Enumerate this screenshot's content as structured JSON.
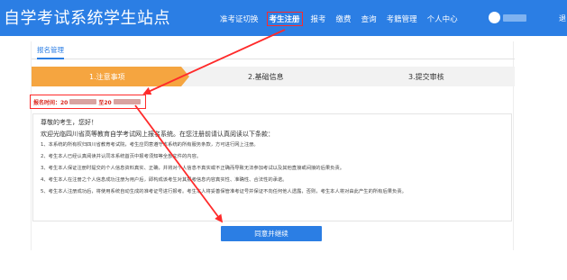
{
  "header": {
    "site_title": "自学考试系统学生站点",
    "nav": [
      "准考证切换",
      "考生注册",
      "报考",
      "缴费",
      "查询",
      "考籍管理",
      "个人中心"
    ],
    "active_nav": "考生注册",
    "right_text": "退"
  },
  "tab": {
    "label": "报名管理"
  },
  "steps": [
    "1.注意事项",
    "2.基础信息",
    "3.提交审核"
  ],
  "time": {
    "prefix": "报名时间：20",
    "middle": "至20"
  },
  "notice": {
    "greeting": "尊敬的考生，您好！",
    "intro": "欢迎光临四川省高等教育自学考试网上报名系统。在您注册前请认真阅读以下条款：",
    "items": [
      "1、本系统的所有权归四川省教育考试院，考生应同意遵守本系统的所有服务条款，方可进行网上注册。",
      "2、考生本人已经认真阅读并认同本系统首页中报考须知等全部文件的内容。",
      "3、考生本人保证注册时提交的个人信息资料真实、正确，并将对个人信息不真实或不正确而导致无法参加考试以及其他直接或间接的后果负责。",
      "4、考生本人在注册之个人信息成功注册为用户后，即构成该考生对其报考信息内容真实性、准确性、合法性的承诺。",
      "5、考生本人注册成功后，将使用系统自动生成的准考证号进行报考。考生本人将妥善保管准考证号并保证不向任何他人透露，否则，考生本人将对由此产生的所有后果负责。"
    ]
  },
  "button": {
    "agree": "同意并继续"
  },
  "colors": {
    "primary": "#2b7ee4",
    "step_active": "#f5a540",
    "annotation": "#ff2a2a",
    "time_text": "#d9261c"
  }
}
